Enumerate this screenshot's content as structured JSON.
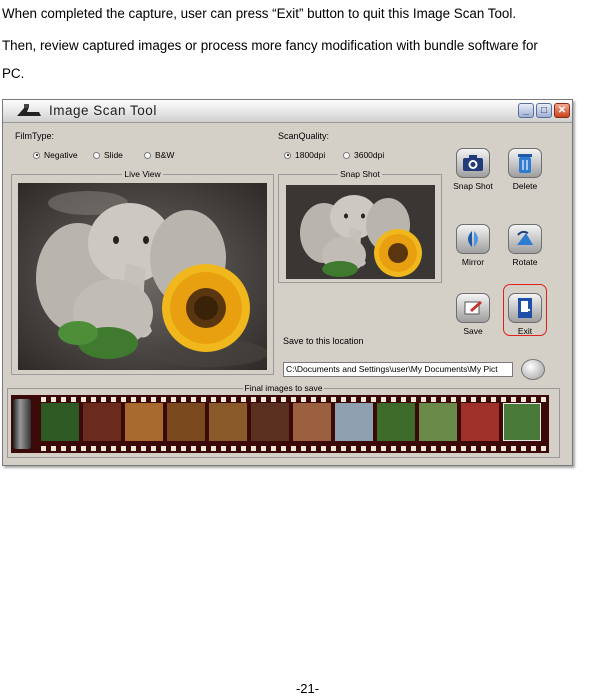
{
  "paragraphs": [
    "When completed the capture, user can press “Exit” button to quit this Image Scan Tool.",
    "Then, review captured images or process more fancy modification with bundle software for",
    "PC."
  ],
  "window": {
    "title": "Image Scan Tool",
    "filmtype_label": "FilmType:",
    "filmtype_options": [
      "Negative",
      "Slide",
      "B&W"
    ],
    "filmtype_selected": "Negative",
    "quality_label": "ScanQuality:",
    "quality_options": [
      "1800dpi",
      "3600dpi"
    ],
    "quality_selected": "1800dpi",
    "live_view_label": "Live View",
    "snap_shot_label": "Snap Shot",
    "save_location_label": "Save to this location",
    "save_path": "C:\\Documents and Settings\\user\\My Documents\\My Pict",
    "final_images_label": "Final images to save",
    "buttons": {
      "snap_shot": "Snap Shot",
      "delete": "Delete",
      "mirror": "Mirror",
      "rotate": "Rotate",
      "save": "Save",
      "exit": "Exit"
    },
    "highlight_color": "#e0201a",
    "film_color": "#3b0a08"
  },
  "page_number": "-21-"
}
